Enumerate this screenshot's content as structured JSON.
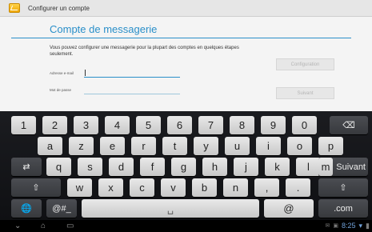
{
  "titlebar": {
    "title": "Configurer un compte",
    "icon": "setup-wizard-icon"
  },
  "form": {
    "heading": "Compte de messagerie",
    "description": "Vous pouvez configurer une messagerie pour la plupart des comptes en quelques étapes seulement.",
    "email_label": "Adresse e-mail",
    "email_value": "",
    "password_label": "Mot de passe",
    "password_value": "",
    "config_button": "Configuration",
    "next_button": "Suivant"
  },
  "keyboard": {
    "row1": [
      "1",
      "2",
      "3",
      "4",
      "5",
      "6",
      "7",
      "8",
      "9",
      "0"
    ],
    "row1_hints": [
      "",
      "",
      "",
      "",
      "",
      "",
      "",
      "",
      "",
      ""
    ],
    "backspace": "⌫",
    "row2": [
      "a",
      "z",
      "e",
      "r",
      "t",
      "y",
      "u",
      "i",
      "o",
      "p"
    ],
    "row3": [
      "q",
      "s",
      "d",
      "f",
      "g",
      "h",
      "j",
      "k",
      "l",
      "m"
    ],
    "tab": "⇄",
    "enter": "Suivant",
    "shift": "⇧",
    "row4": [
      "w",
      "x",
      "c",
      "v",
      "b",
      "n"
    ],
    "comma": ",",
    "period": ".",
    "globe": "🌐",
    "symbols": "@#_",
    "space": "␣",
    "at": "@",
    "dotcom": ".com"
  },
  "navbar": {
    "back": "⌄",
    "home": "⌂",
    "recent": "▭",
    "time": "8:25"
  }
}
